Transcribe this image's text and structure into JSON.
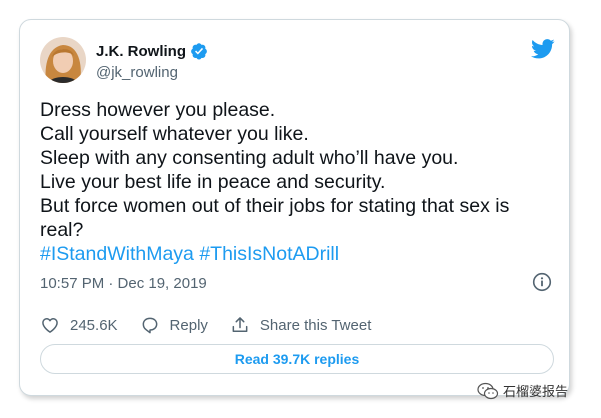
{
  "author": {
    "name": "J.K. Rowling",
    "handle": "@jk_rowling",
    "avatar_icon": "avatar"
  },
  "tweet": {
    "lines": [
      "Dress however you please.",
      "Call yourself whatever you like.",
      "Sleep with any consenting adult who’ll have you.",
      "Live your best life in peace and security.",
      "But force women out of their jobs for stating that sex is",
      "real?"
    ],
    "hashtags": "#IStandWithMaya #ThisIsNotADrill",
    "timestamp": "10:57 PM · Dec 19, 2019"
  },
  "actions": {
    "like_count": "245.6K",
    "reply_label": "Reply",
    "share_label": "Share this Tweet"
  },
  "replies_button": "Read 39.7K replies",
  "watermark": "石榴婆报告",
  "colors": {
    "accent": "#1d9bf0",
    "text": "#0f1419",
    "secondary": "#536471",
    "border": "#cfd9de"
  },
  "icons": [
    "verified-badge-icon",
    "twitter-bird-icon",
    "info-icon",
    "heart-icon",
    "reply-bubble-icon",
    "share-icon",
    "wechat-icon"
  ]
}
